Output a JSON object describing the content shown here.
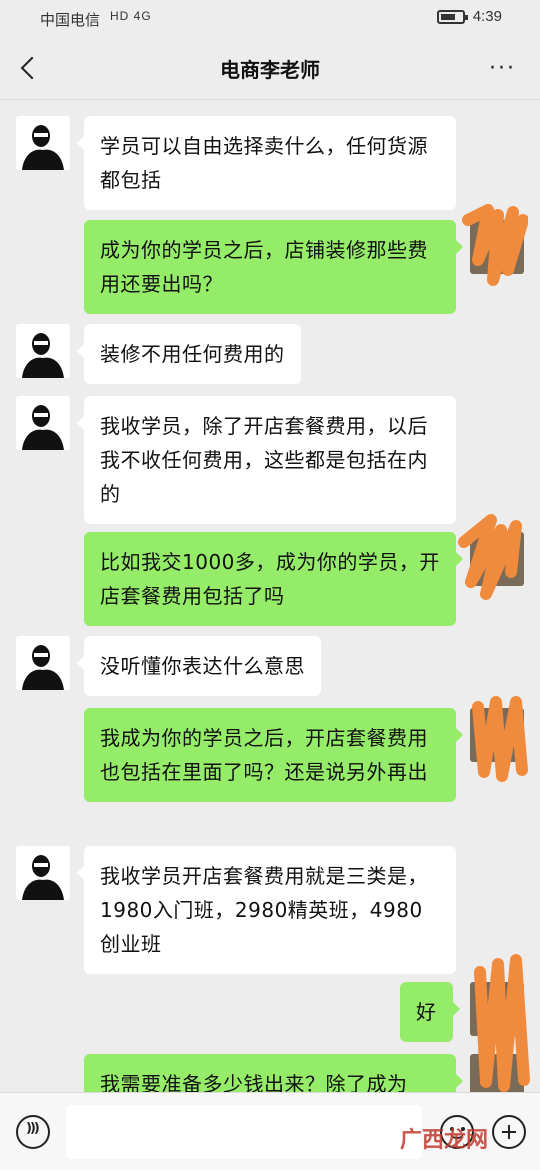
{
  "status_bar": {
    "carrier": "中国电信",
    "network": "HD 4G",
    "time": "4:39"
  },
  "header": {
    "title": "电商李老师",
    "more_label": "···"
  },
  "messages": [
    {
      "sender": "teacher",
      "text": "学员可以自由选择卖什么，任何货源都包括"
    },
    {
      "sender": "me",
      "text": "成为你的学员之后，店铺装修那些费用还要出吗？"
    },
    {
      "sender": "teacher",
      "text": "装修不用任何费用的"
    },
    {
      "sender": "teacher",
      "text": "我收学员，除了开店套餐费用，以后我不收任何费用，这些都是包括在内的"
    },
    {
      "sender": "me",
      "text": "比如我交1000多，成为你的学员，开店套餐费用包括了吗"
    },
    {
      "sender": "teacher",
      "text": "没听懂你表达什么意思"
    },
    {
      "sender": "me",
      "text": "我成为你的学员之后，开店套餐费用也包括在里面了吗？还是说另外再出"
    },
    {
      "sender": "teacher",
      "text": "我收学员开店套餐费用就是三类是，1980入门班，2980精英班，4980创业班"
    },
    {
      "sender": "me",
      "text": "好"
    },
    {
      "sender": "me",
      "text": "我需要准备多少钱出来？除了成为"
    }
  ],
  "input_bar": {
    "placeholder": ""
  },
  "watermark": "广西龙网",
  "colors": {
    "outgoing_bubble": "#95ec69",
    "incoming_bubble": "#ffffff",
    "background": "#ededed",
    "scribble": "#f08a3c"
  },
  "icons": [
    "back-arrow-icon",
    "more-icon",
    "voice-icon",
    "emoji-icon",
    "plus-icon"
  ]
}
